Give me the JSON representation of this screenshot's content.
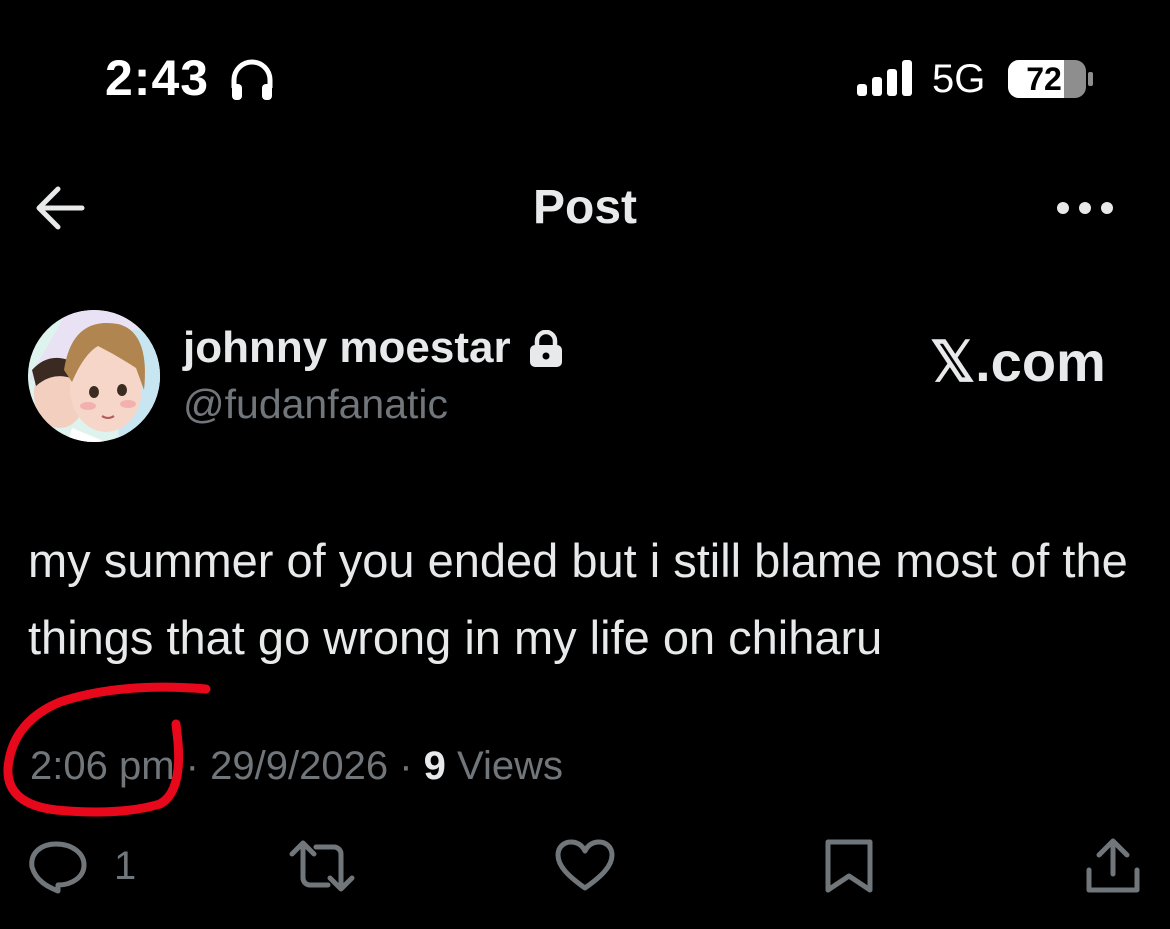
{
  "status_bar": {
    "time": "2:43",
    "headphones_icon": "headphones-icon",
    "signal_icon": "cellular-signal-icon",
    "network": "5G",
    "battery_level": "72"
  },
  "nav": {
    "back_icon": "arrow-left-icon",
    "title": "Post",
    "more_icon": "more-horizontal-icon"
  },
  "author": {
    "name": "johnny moestar",
    "handle": "@fudanfanatic",
    "lock_icon": "lock-icon"
  },
  "watermark": "𝕏.com",
  "post": {
    "text": "my summer of you ended but i still blame most of the things that go wrong in my life on chiharu"
  },
  "meta": {
    "time": "2:06 pm",
    "sep1": "·",
    "date": "29/9/2026",
    "sep2": "·",
    "views_count": "9",
    "views_label": "Views"
  },
  "annotation": {
    "color": "#e8081c"
  },
  "actions": {
    "reply_count": "1",
    "icons": [
      "reply-icon",
      "repost-icon",
      "like-icon",
      "bookmark-icon",
      "share-icon"
    ]
  },
  "colors": {
    "background": "#000000",
    "text": "#e7e9ea",
    "secondary": "#71767b"
  }
}
